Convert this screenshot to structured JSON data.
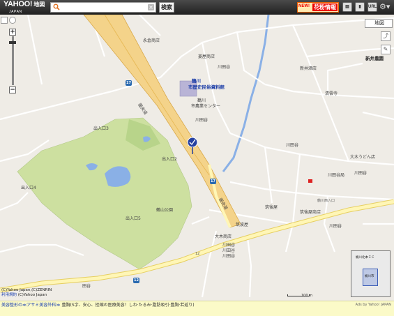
{
  "header": {
    "logo_main": "YAHOO!",
    "logo_jp": "地図",
    "logo_sub": "JAPAN",
    "search_placeholder": "",
    "search_button": "検索",
    "hanami_new": "NEW!",
    "hanami_label": "花粉情報",
    "icons": [
      "printer-icon",
      "mobile-icon",
      "url-icon",
      "settings-icon"
    ],
    "url_label": "URL"
  },
  "controls": {
    "layer_label": "地図",
    "zoom_in": "+",
    "zoom_out": "−"
  },
  "map_labels": {
    "l1": "永倉商店",
    "l2": "菱屋商店",
    "l3": "鶴川",
    "l4": "市歴史民俗資料館",
    "l5": "鶴川",
    "l6": "市農業センター",
    "l7": "川田谷",
    "l8": "新井酒店",
    "l9": "新井農園",
    "l10": "清雲寺",
    "l11": "出入口3",
    "l12": "出入口2",
    "l13": "出入口4",
    "l14": "出入口5",
    "l15": "鶴山公園",
    "l16": "川田谷",
    "l17": "大木うどん店",
    "l18": "川田谷",
    "l19": "川田谷",
    "l20": "川田谷局",
    "l21": "鶴川西入口",
    "l22": "筑後屋",
    "l23": "筑後屋商店",
    "l24": "川田谷",
    "l25": "大木商店",
    "l26": "筑波屋",
    "l27": "川田谷",
    "l28": "川田谷",
    "l29": "川田谷",
    "l30": "17",
    "l31": "17",
    "l32": "12",
    "l33": "12",
    "l34": "圏央道",
    "l35": "圏央道",
    "l36": "田谷"
  },
  "footer": {
    "copyright": "(C)Yahoo Japan,(C)ZENRIN",
    "link": "利用規約",
    "copyright2": "(C)Yahoo Japan",
    "scale": "100 m"
  },
  "minimap": {
    "label1": "桶川北本ＩＣ",
    "label2": "桶川市"
  },
  "ad": {
    "link": "美容整形の≪アサミ美容外科≫",
    "text": "豊胸(S字、安心、挫縮の医療美容！しわ·たるみ·脂肪吸引·豊胸·若返り)",
    "by": "Ads by Yahoo! JAPAN"
  },
  "colors": {
    "expressway": "#f4d38a",
    "highway": "#fff6b6",
    "park": "#cde0a0",
    "water": "#8ab0e6",
    "pin": "#2540a0"
  }
}
